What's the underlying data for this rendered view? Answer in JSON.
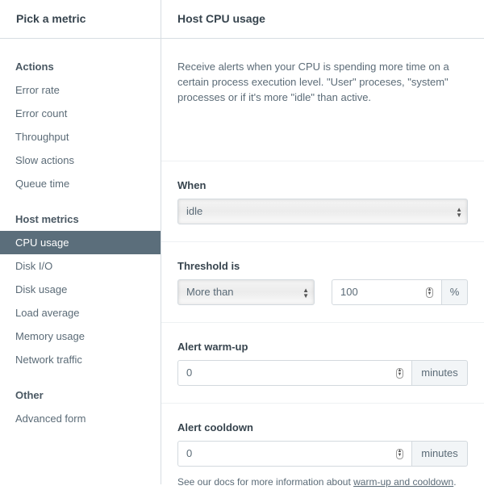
{
  "sidebar": {
    "title": "Pick a metric",
    "sections": [
      {
        "heading": "Actions",
        "items": [
          "Error rate",
          "Error count",
          "Throughput",
          "Slow actions",
          "Queue time"
        ]
      },
      {
        "heading": "Host metrics",
        "items": [
          "CPU usage",
          "Disk I/O",
          "Disk usage",
          "Load average",
          "Memory usage",
          "Network traffic"
        ]
      },
      {
        "heading": "Other",
        "items": [
          "Advanced form"
        ]
      }
    ],
    "active": "CPU usage"
  },
  "main": {
    "title": "Host CPU usage",
    "description": "Receive alerts when your CPU is spending more time on a certain process execution level. \"User\" proceses, \"system\" processes or if it's more \"idle\" than active.",
    "when": {
      "label": "When",
      "value": "idle"
    },
    "threshold": {
      "label": "Threshold is",
      "operator": "More than",
      "value": "100",
      "unit": "%"
    },
    "warmup": {
      "label": "Alert warm-up",
      "value": "0",
      "unit": "minutes"
    },
    "cooldown": {
      "label": "Alert cooldown",
      "value": "0",
      "unit": "minutes"
    },
    "note": {
      "text": "See our docs for more information about ",
      "link": "warm-up and cooldown",
      "suffix": "."
    }
  }
}
